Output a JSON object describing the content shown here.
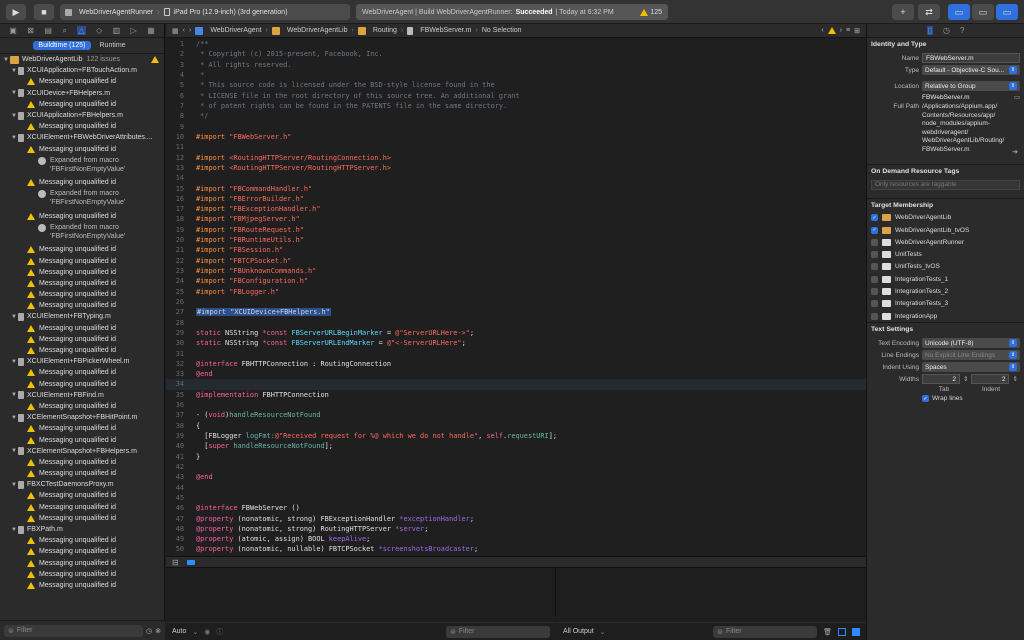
{
  "toolbar": {
    "scheme": "WebDriverAgentRunner",
    "device": "iPad Pro (12.9-inch) (3rd generation)",
    "activity_prefix": "WebDriverAgent | Build WebDriverAgentRunner:",
    "activity_status": "Succeeded",
    "activity_time": "| Today at 6:32 PM",
    "warning_count": "125"
  },
  "navigator": {
    "segments": [
      "Buildtime (125)",
      "Runtime"
    ],
    "project": "WebDriverAgentLib",
    "issues": "122 issues",
    "filter_placeholder": "Filter",
    "rows": [
      {
        "k": "file",
        "t": "XCUIApplication+FBTouchAction.m"
      },
      {
        "k": "warn",
        "t": "Messaging unqualified id"
      },
      {
        "k": "file",
        "t": "XCUIDevice+FBHelpers.m"
      },
      {
        "k": "warn",
        "t": "Messaging unqualified id"
      },
      {
        "k": "file",
        "t": "XCUIApplication+FBHelpers.m"
      },
      {
        "k": "warn",
        "t": "Messaging unqualified id"
      },
      {
        "k": "file",
        "t": "XCUIElement+FBWebDriverAttributes...."
      },
      {
        "k": "warn",
        "t": "Messaging unqualified id"
      },
      {
        "k": "info",
        "t": "Expanded from macro 'FBFirstNonEmptyValue'"
      },
      {
        "k": "warn",
        "t": "Messaging unqualified id"
      },
      {
        "k": "info",
        "t": "Expanded from macro 'FBFirstNonEmptyValue'"
      },
      {
        "k": "warn",
        "t": "Messaging unqualified id"
      },
      {
        "k": "info",
        "t": "Expanded from macro 'FBFirstNonEmptyValue'"
      },
      {
        "k": "warn",
        "t": "Messaging unqualified id"
      },
      {
        "k": "warn",
        "t": "Messaging unqualified id"
      },
      {
        "k": "warn",
        "t": "Messaging unqualified id"
      },
      {
        "k": "warn",
        "t": "Messaging unqualified id"
      },
      {
        "k": "warn",
        "t": "Messaging unqualified id"
      },
      {
        "k": "warn",
        "t": "Messaging unqualified id"
      },
      {
        "k": "file",
        "t": "XCUIElement+FBTyping.m"
      },
      {
        "k": "warn",
        "t": "Messaging unqualified id"
      },
      {
        "k": "warn",
        "t": "Messaging unqualified id"
      },
      {
        "k": "warn",
        "t": "Messaging unqualified id"
      },
      {
        "k": "file",
        "t": "XCUIElement+FBPickerWheel.m"
      },
      {
        "k": "warn",
        "t": "Messaging unqualified id"
      },
      {
        "k": "warn",
        "t": "Messaging unqualified id"
      },
      {
        "k": "file",
        "t": "XCUIElement+FBFind.m"
      },
      {
        "k": "warn",
        "t": "Messaging unqualified id"
      },
      {
        "k": "file",
        "t": "XCElementSnapshot+FBHitPoint.m"
      },
      {
        "k": "warn",
        "t": "Messaging unqualified id"
      },
      {
        "k": "warn",
        "t": "Messaging unqualified id"
      },
      {
        "k": "file",
        "t": "XCElementSnapshot+FBHelpers.m"
      },
      {
        "k": "warn",
        "t": "Messaging unqualified id"
      },
      {
        "k": "warn",
        "t": "Messaging unqualified id"
      },
      {
        "k": "file",
        "t": "FBXCTestDaemonsProxy.m"
      },
      {
        "k": "warn",
        "t": "Messaging unqualified id"
      },
      {
        "k": "warn",
        "t": "Messaging unqualified id"
      },
      {
        "k": "warn",
        "t": "Messaging unqualified id"
      },
      {
        "k": "file",
        "t": "FBXPath.m"
      },
      {
        "k": "warn",
        "t": "Messaging unqualified id"
      },
      {
        "k": "warn",
        "t": "Messaging unqualified id"
      },
      {
        "k": "warn",
        "t": "Messaging unqualified id"
      },
      {
        "k": "warn",
        "t": "Messaging unqualified id"
      },
      {
        "k": "warn",
        "t": "Messaging unqualified id"
      }
    ]
  },
  "jumpbar": [
    "WebDriverAgent",
    "WebDriverAgentLib",
    "Routing",
    "FBWebServer.m",
    "No Selection"
  ],
  "code": [
    [
      [
        "cmt",
        "/**"
      ]
    ],
    [
      [
        "cmt",
        " * Copyright (c) 2015-present, Facebook, Inc."
      ]
    ],
    [
      [
        "cmt",
        " * All rights reserved."
      ]
    ],
    [
      [
        "cmt",
        " *"
      ]
    ],
    [
      [
        "cmt",
        " * This source code is licensed under the BSD-style license found in the"
      ]
    ],
    [
      [
        "cmt",
        " * LICENSE file in the root directory of this source tree. An additional grant"
      ]
    ],
    [
      [
        "cmt",
        " * of patent rights can be found in the PATENTS file in the same directory."
      ]
    ],
    [
      [
        "cmt",
        " */"
      ]
    ],
    [
      [
        "pl",
        ""
      ]
    ],
    [
      [
        "pp",
        "#import "
      ],
      [
        "str",
        "\"FBWebServer.h\""
      ]
    ],
    [
      [
        "pl",
        ""
      ]
    ],
    [
      [
        "pp",
        "#import "
      ],
      [
        "str",
        "<RoutingHTTPServer/RoutingConnection.h>"
      ]
    ],
    [
      [
        "pp",
        "#import "
      ],
      [
        "str",
        "<RoutingHTTPServer/RoutingHTTPServer.h>"
      ]
    ],
    [
      [
        "pl",
        ""
      ]
    ],
    [
      [
        "pp",
        "#import "
      ],
      [
        "str",
        "\"FBCommandHandler.h\""
      ]
    ],
    [
      [
        "pp",
        "#import "
      ],
      [
        "str",
        "\"FBErrorBuilder.h\""
      ]
    ],
    [
      [
        "pp",
        "#import "
      ],
      [
        "str",
        "\"FBExceptionHandler.h\""
      ]
    ],
    [
      [
        "pp",
        "#import "
      ],
      [
        "str",
        "\"FBMjpegServer.h\""
      ]
    ],
    [
      [
        "pp",
        "#import "
      ],
      [
        "str",
        "\"FBRouteRequest.h\""
      ]
    ],
    [
      [
        "pp",
        "#import "
      ],
      [
        "str",
        "\"FBRuntimeUtils.h\""
      ]
    ],
    [
      [
        "pp",
        "#import "
      ],
      [
        "str",
        "\"FBSession.h\""
      ]
    ],
    [
      [
        "pp",
        "#import "
      ],
      [
        "str",
        "\"FBTCPSocket.h\""
      ]
    ],
    [
      [
        "pp",
        "#import "
      ],
      [
        "str",
        "\"FBUnknownCommands.h\""
      ]
    ],
    [
      [
        "pp",
        "#import "
      ],
      [
        "str",
        "\"FBConfiguration.h\""
      ]
    ],
    [
      [
        "pp",
        "#import "
      ],
      [
        "str",
        "\"FBLogger.h\""
      ]
    ],
    [
      [
        "pl",
        ""
      ]
    ],
    [
      [
        "sel",
        "#import \"XCUIDevice+FBHelpers.h\""
      ]
    ],
    [
      [
        "pl",
        ""
      ]
    ],
    [
      [
        "kw",
        "static "
      ],
      [
        "pl",
        "NSString "
      ],
      [
        "kw",
        "*const "
      ],
      [
        "ty",
        "FBServerURLBeginMarker"
      ],
      [
        "pl",
        " = "
      ],
      [
        "str",
        "@\"ServerURLHere->\""
      ],
      [
        "pl",
        ";"
      ]
    ],
    [
      [
        "kw",
        "static "
      ],
      [
        "pl",
        "NSString "
      ],
      [
        "kw",
        "*const "
      ],
      [
        "ty",
        "FBServerURLEndMarker"
      ],
      [
        "pl",
        " = "
      ],
      [
        "str",
        "@\"<-ServerURLHere\""
      ],
      [
        "pl",
        ";"
      ]
    ],
    [
      [
        "pl",
        ""
      ]
    ],
    [
      [
        "kw",
        "@interface "
      ],
      [
        "pl",
        "FBHTTPConnection : RoutingConnection"
      ]
    ],
    [
      [
        "kw",
        "@end"
      ]
    ],
    [
      [
        "pl",
        ""
      ]
    ],
    [
      [
        "kw",
        "@implementation "
      ],
      [
        "pl",
        "FBHTTPConnection"
      ]
    ],
    [
      [
        "pl",
        ""
      ]
    ],
    [
      [
        "pl",
        "- ("
      ],
      [
        "kw",
        "void"
      ],
      [
        "pl",
        ")"
      ],
      [
        "fn",
        "handleResourceNotFound"
      ]
    ],
    [
      [
        "pl",
        "{"
      ]
    ],
    [
      [
        "pl",
        "  ["
      ],
      [
        "pl",
        "FBLogger "
      ],
      [
        "fn",
        "logFmt:"
      ],
      [
        "str",
        "@\"Received request for %@ which we do not handle\""
      ],
      [
        "pl",
        ", "
      ],
      [
        "kw",
        "self"
      ],
      [
        "pl",
        "."
      ],
      [
        "fn",
        "requestURI"
      ],
      [
        "pl",
        "];"
      ]
    ],
    [
      [
        "pl",
        "  ["
      ],
      [
        "kw",
        "super "
      ],
      [
        "fn",
        "handleResourceNotFound"
      ],
      [
        "pl",
        "];"
      ]
    ],
    [
      [
        "pl",
        "}"
      ]
    ],
    [
      [
        "pl",
        ""
      ]
    ],
    [
      [
        "kw",
        "@end"
      ]
    ],
    [
      [
        "pl",
        ""
      ]
    ],
    [
      [
        "pl",
        ""
      ]
    ],
    [
      [
        "kw",
        "@interface "
      ],
      [
        "pl",
        "FBWebServer ()"
      ]
    ],
    [
      [
        "kw",
        "@property "
      ],
      [
        "pl",
        "(nonatomic, strong) FBExceptionHandler "
      ],
      [
        "prop",
        "*exceptionHandler"
      ],
      [
        "pl",
        ";"
      ]
    ],
    [
      [
        "kw",
        "@property "
      ],
      [
        "pl",
        "(nonatomic, strong) RoutingHTTPServer "
      ],
      [
        "prop",
        "*server"
      ],
      [
        "pl",
        ";"
      ]
    ],
    [
      [
        "kw",
        "@property "
      ],
      [
        "pl",
        "(atomic, assign) BOOL "
      ],
      [
        "prop",
        "keepAlive"
      ],
      [
        "pl",
        ";"
      ]
    ],
    [
      [
        "kw",
        "@property "
      ],
      [
        "pl",
        "(nonatomic, nullable) FBTCPSocket "
      ],
      [
        "prop",
        "*screenshotsBroadcaster"
      ],
      [
        "pl",
        ";"
      ]
    ]
  ],
  "current_line": 34,
  "debug": {
    "left_select": "Auto",
    "filter_left": "Filter",
    "output_select": "All Output",
    "filter_right": "Filter"
  },
  "inspector": {
    "identity_title": "Identity and Type",
    "name_label": "Name",
    "name_value": "FBWebServer.m",
    "type_label": "Type",
    "type_value": "Default - Objective-C Sou...",
    "location_label": "Location",
    "location_value": "Relative to Group",
    "location_file": "FBWebServer.m",
    "fullpath_label": "Full Path",
    "fullpath_value": "/Applications/Appium.app/ Contents/Resources/app/ node_modules/appium- webdriveragent/ WebDriverAgentLib/Routing/ FBWebServer.m",
    "odr_title": "On Demand Resource Tags",
    "odr_placeholder": "Only resources are taggable",
    "target_title": "Target Membership",
    "targets": [
      {
        "name": "WebDriverAgentLib",
        "checked": true,
        "proj": true
      },
      {
        "name": "WebDriverAgentLib_tvOS",
        "checked": true,
        "proj": true
      },
      {
        "name": "WebDriverAgentRunner",
        "checked": false,
        "proj": false
      },
      {
        "name": "UnitTests",
        "checked": false,
        "proj": false
      },
      {
        "name": "UnitTests_tvOS",
        "checked": false,
        "proj": false
      },
      {
        "name": "IntegrationTests_1",
        "checked": false,
        "proj": false
      },
      {
        "name": "IntegrationTests_2",
        "checked": false,
        "proj": false
      },
      {
        "name": "IntegrationTests_3",
        "checked": false,
        "proj": false
      },
      {
        "name": "IntegrationApp",
        "checked": false,
        "proj": false
      }
    ],
    "text_title": "Text Settings",
    "encoding_label": "Text Encoding",
    "encoding_value": "Unicode (UTF-8)",
    "endings_label": "Line Endings",
    "endings_value": "No Explicit Line Endings",
    "indent_label": "Indent Using",
    "indent_value": "Spaces",
    "widths_label": "Widths",
    "tab_value": "2",
    "indent_value_num": "2",
    "tab_label": "Tab",
    "indent_sub_label": "Indent",
    "wrap_label": "Wrap lines"
  }
}
